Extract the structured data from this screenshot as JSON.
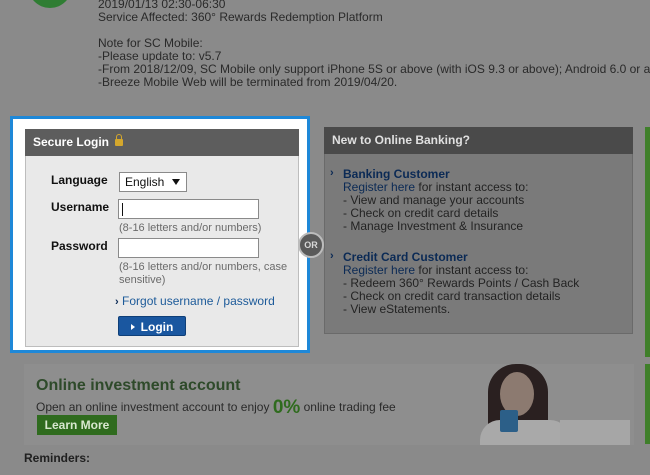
{
  "notice": {
    "lines": [
      "2019/01/13 02:30-06:30",
      "Service Affected: 360° Rewards Redemption Platform",
      "",
      "Note for SC Mobile:",
      "-Please update to: v5.7",
      "-From 2018/12/09, SC Mobile only support iPhone 5S or above (with iOS 9.3 or above); Android 6.0 or a",
      "-Breeze Mobile Web will be terminated from 2019/04/20."
    ]
  },
  "login": {
    "title": "Secure Login",
    "language_label": "Language",
    "language_value": "English",
    "username_label": "Username",
    "username_hint": "(8-16 letters and/or numbers)",
    "password_label": "Password",
    "password_hint_1": "(8-16 letters and/or numbers, case",
    "password_hint_2": "sensitive)",
    "forgot_link": "Forgot username / password",
    "login_button": "Login"
  },
  "or_text": "OR",
  "new_banking": {
    "title": "New to Online Banking?",
    "sections": [
      {
        "heading": "Banking Customer",
        "register_link": "Register here",
        "register_suffix": " for instant access to:",
        "items": [
          "- View and manage your accounts",
          "- Check on credit card details",
          "- Manage Investment & Insurance"
        ]
      },
      {
        "heading": "Credit Card Customer",
        "register_link": "Register here",
        "register_suffix": " for instant access to:",
        "items": [
          "- Redeem 360° Rewards Points / Cash Back",
          "- Check on credit card transaction details",
          "- View eStatements."
        ]
      }
    ]
  },
  "banner": {
    "title": "Online investment account",
    "sub_before": "Open an online investment account to enjoy ",
    "pct": "0%",
    "sub_after": " online trading fee",
    "learn_more": "Learn More"
  },
  "reminders": "Reminders:",
  "colors": {
    "login_border": "#1e88d8",
    "login_button": "#1a57a0",
    "link": "#1c5a99"
  }
}
